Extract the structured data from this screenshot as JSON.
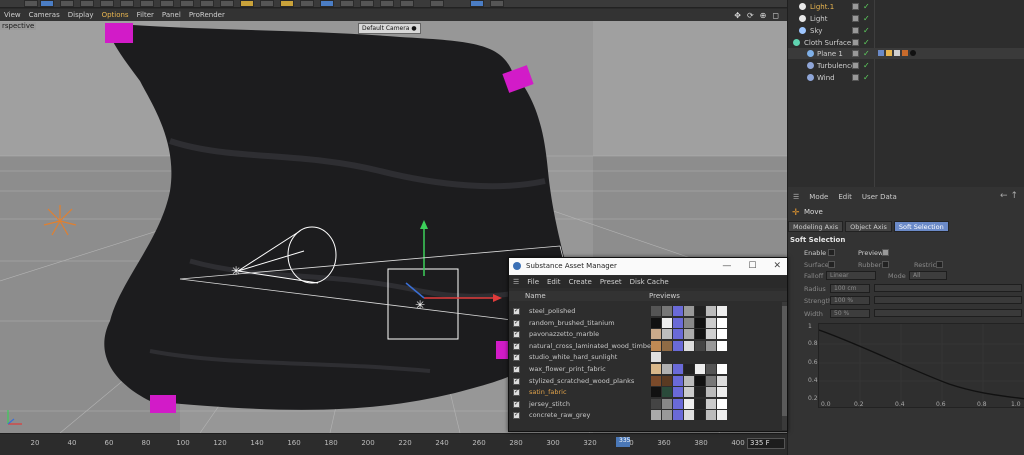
{
  "viewport_menu": {
    "items": [
      "View",
      "Cameras",
      "Display",
      "Options",
      "Filter",
      "Panel",
      "ProRender"
    ],
    "active_item": "Options",
    "nav_icons": [
      "move-view-icon",
      "rotate-view-icon",
      "zoom-view-icon",
      "maximize-view-icon"
    ]
  },
  "viewport": {
    "projection_label": "rspective",
    "camera_label": "Default Camera",
    "camera_label_suffix": "●"
  },
  "timeline": {
    "ticks": [
      "20",
      "40",
      "60",
      "80",
      "100",
      "120",
      "140",
      "160",
      "180",
      "200",
      "220",
      "240",
      "260",
      "280",
      "300",
      "320",
      "340",
      "360",
      "380",
      "400"
    ],
    "current_frame": "335",
    "end_frame": "335 F"
  },
  "object_manager": {
    "objects": [
      {
        "name": "Light.1",
        "selected": true,
        "icon": "light-icon"
      },
      {
        "name": "Light",
        "selected": false,
        "icon": "light-icon"
      },
      {
        "name": "Sky",
        "selected": false,
        "icon": "sky-icon"
      },
      {
        "name": "Cloth Surface",
        "selected": false,
        "icon": "cloth-surface-icon"
      },
      {
        "name": "Plane 1",
        "selected": false,
        "icon": "plane-icon"
      },
      {
        "name": "Turbulence",
        "selected": false,
        "icon": "turbulence-icon"
      },
      {
        "name": "Wind",
        "selected": false,
        "icon": "wind-icon"
      }
    ]
  },
  "attributes": {
    "menu": [
      "Mode",
      "Edit",
      "User Data"
    ],
    "tool_name": "Move",
    "tabs": [
      "Modeling Axis",
      "Object Axis",
      "Soft Selection"
    ],
    "active_tab": "Soft Selection",
    "section_title": "Soft Selection",
    "fields": {
      "enable": "Enable",
      "preview": "Preview",
      "surface": "Surface",
      "rubber": "Rubber",
      "restrict": "Restrict",
      "falloff": "Falloff",
      "falloff_value": "Linear",
      "mode": "Mode",
      "mode_value": "All",
      "radius": "Radius",
      "radius_value": "100 cm",
      "strength": "Strength",
      "strength_value": "100 %",
      "width": "Width",
      "width_value": "50 %"
    },
    "graph": {
      "y_labels": [
        "1",
        "0.8",
        "0.6",
        "0.4",
        "0.2"
      ],
      "x_labels": [
        "0.0",
        "0.2",
        "0.4",
        "0.6",
        "0.8",
        "1.0"
      ]
    }
  },
  "substance_window": {
    "title": "Substance Asset Manager",
    "menu": [
      "File",
      "Edit",
      "Create",
      "Preset",
      "Disk Cache"
    ],
    "columns": {
      "name": "Name",
      "previews": "Previews"
    },
    "materials": [
      {
        "name": "steel_polished",
        "highlighted": false
      },
      {
        "name": "random_brushed_titanium",
        "highlighted": false
      },
      {
        "name": "pavonazzetto_marble",
        "highlighted": false
      },
      {
        "name": "natural_cross_laminated_wood_timber",
        "highlighted": false
      },
      {
        "name": "studio_white_hard_sunlight",
        "highlighted": false
      },
      {
        "name": "wax_flower_print_fabric",
        "highlighted": false
      },
      {
        "name": "stylized_scratched_wood_planks",
        "highlighted": false
      },
      {
        "name": "satin_fabric",
        "highlighted": true
      },
      {
        "name": "jersey_stitch",
        "highlighted": false
      },
      {
        "name": "concrete_raw_grey",
        "highlighted": false
      }
    ]
  },
  "colors": {
    "accent_orange": "#e8b550",
    "selection_blue": "#6b8ac8",
    "pin_magenta": "#e020d0",
    "axis_green": "#3ccf5a",
    "axis_red": "#e03b3b",
    "axis_blue": "#3a6fd6"
  }
}
